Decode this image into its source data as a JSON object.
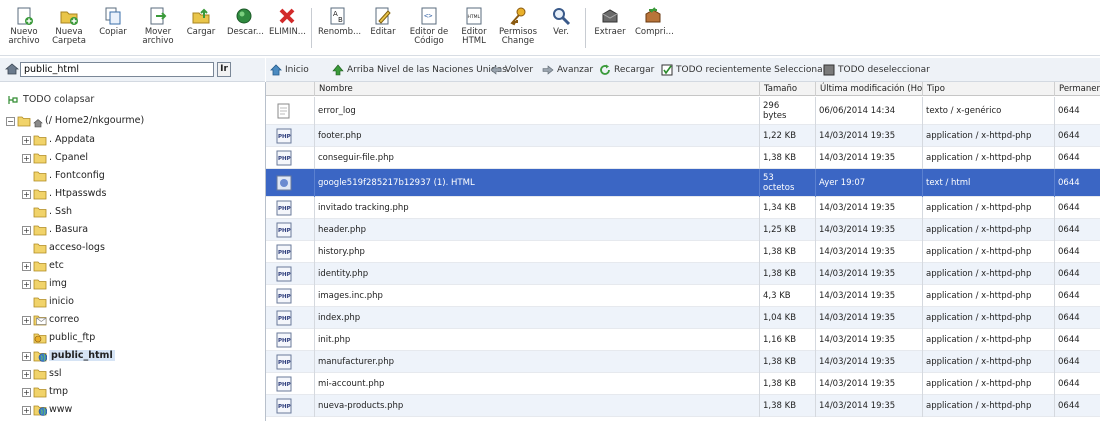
{
  "toolbar": {
    "buttons": [
      {
        "label": "Nuevo\narchivo",
        "icon": "new-file-icon"
      },
      {
        "label": "Nueva\nCarpeta",
        "icon": "new-folder-icon"
      },
      {
        "label": "Copiar",
        "icon": "copy-icon"
      },
      {
        "label": "Mover\narchivo",
        "icon": "move-file-icon"
      },
      {
        "label": "Cargar",
        "icon": "upload-icon"
      },
      {
        "label": "Descar...",
        "icon": "download-icon"
      },
      {
        "label": "ELIMIN...",
        "icon": "delete-icon"
      },
      {
        "label": "Renomb...",
        "icon": "rename-icon"
      },
      {
        "label": "Editar",
        "icon": "edit-icon"
      },
      {
        "label": "Editor de\nCódigo",
        "icon": "code-editor-icon"
      },
      {
        "label": "Editor\nHTML",
        "icon": "html-editor-icon"
      },
      {
        "label": "Permisos\nChange",
        "icon": "permissions-icon"
      },
      {
        "label": "Ver.",
        "icon": "view-icon"
      },
      {
        "label": "Extraer",
        "icon": "extract-icon"
      },
      {
        "label": "Compri...",
        "icon": "compress-icon"
      }
    ]
  },
  "path": {
    "value": "public_html",
    "go_label": "Ir"
  },
  "actions": [
    {
      "label": "Inicio",
      "icon": "home-icon"
    },
    {
      "label": "Arriba Nivel de las Naciones Unidas",
      "icon": "up-level-icon"
    },
    {
      "label": "Volver",
      "icon": "back-icon"
    },
    {
      "label": "Avanzar",
      "icon": "forward-icon"
    },
    {
      "label": "Recargar",
      "icon": "reload-icon"
    },
    {
      "label": "TODO recientemente Seleccionar",
      "icon": "select-all-icon"
    },
    {
      "label": "TODO deseleccionar",
      "icon": "deselect-all-icon"
    }
  ],
  "tree": {
    "collapse_label": "TODO colapsar",
    "root_label": "(/ Home2/nkgourme)",
    "items": [
      {
        "label": ". Appdata",
        "expandable": true,
        "icon": "folder"
      },
      {
        "label": ". Cpanel",
        "expandable": true,
        "icon": "folder"
      },
      {
        "label": ". Fontconfig",
        "expandable": false,
        "icon": "folder"
      },
      {
        "label": ". Htpasswds",
        "expandable": true,
        "icon": "folder"
      },
      {
        "label": ". Ssh",
        "expandable": false,
        "icon": "folder"
      },
      {
        "label": ". Basura",
        "expandable": true,
        "icon": "folder"
      },
      {
        "label": "acceso-logs",
        "expandable": false,
        "icon": "folder"
      },
      {
        "label": "etc",
        "expandable": true,
        "icon": "folder"
      },
      {
        "label": "img",
        "expandable": true,
        "icon": "folder"
      },
      {
        "label": "inicio",
        "expandable": false,
        "icon": "folder"
      },
      {
        "label": "correo",
        "expandable": true,
        "icon": "mail-folder"
      },
      {
        "label": "public_ftp",
        "expandable": false,
        "icon": "ftp-folder"
      },
      {
        "label": "public_html",
        "expandable": true,
        "icon": "globe-folder",
        "selected": true
      },
      {
        "label": "ssl",
        "expandable": true,
        "icon": "folder"
      },
      {
        "label": "tmp",
        "expandable": true,
        "icon": "folder"
      },
      {
        "label": "www",
        "expandable": true,
        "icon": "globe-folder"
      }
    ]
  },
  "table": {
    "columns": [
      "Nombre",
      "Tamaño",
      "Última modificación (Hora",
      "Tipo",
      "Permaner"
    ],
    "rows": [
      {
        "icon": "text-file",
        "name": "error_log",
        "size": "296\nbytes",
        "modified": "06/06/2014 14:34",
        "type": "texto / x-genérico",
        "perm": "0644"
      },
      {
        "icon": "php-file",
        "name": "footer.php",
        "size": "1,22 KB",
        "modified": "14/03/2014 19:35",
        "type": "application / x-httpd-php",
        "perm": "0644"
      },
      {
        "icon": "php-file",
        "name": "conseguir-file.php",
        "size": "1,38 KB",
        "modified": "14/03/2014 19:35",
        "type": "application / x-httpd-php",
        "perm": "0644"
      },
      {
        "icon": "html-file",
        "name": "google519f285217b12937 (1). HTML",
        "size": "53\noctetos",
        "modified": "Ayer 19:07",
        "type": "text / html",
        "perm": "0644",
        "selected": true
      },
      {
        "icon": "php-file",
        "name": "invitado tracking.php",
        "size": "1,34 KB",
        "modified": "14/03/2014 19:35",
        "type": "application / x-httpd-php",
        "perm": "0644"
      },
      {
        "icon": "php-file",
        "name": "header.php",
        "size": "1,25 KB",
        "modified": "14/03/2014 19:35",
        "type": "application / x-httpd-php",
        "perm": "0644"
      },
      {
        "icon": "php-file",
        "name": "history.php",
        "size": "1,38 KB",
        "modified": "14/03/2014 19:35",
        "type": "application / x-httpd-php",
        "perm": "0644"
      },
      {
        "icon": "php-file",
        "name": "identity.php",
        "size": "1,38 KB",
        "modified": "14/03/2014 19:35",
        "type": "application / x-httpd-php",
        "perm": "0644"
      },
      {
        "icon": "php-file",
        "name": "images.inc.php",
        "size": "4,3 KB",
        "modified": "14/03/2014 19:35",
        "type": "application / x-httpd-php",
        "perm": "0644"
      },
      {
        "icon": "php-file",
        "name": "index.php",
        "size": "1,04 KB",
        "modified": "14/03/2014 19:35",
        "type": "application / x-httpd-php",
        "perm": "0644"
      },
      {
        "icon": "php-file",
        "name": "init.php",
        "size": "1,16 KB",
        "modified": "14/03/2014 19:35",
        "type": "application / x-httpd-php",
        "perm": "0644"
      },
      {
        "icon": "php-file",
        "name": "manufacturer.php",
        "size": "1,38 KB",
        "modified": "14/03/2014 19:35",
        "type": "application / x-httpd-php",
        "perm": "0644"
      },
      {
        "icon": "php-file",
        "name": "mi-account.php",
        "size": "1,38 KB",
        "modified": "14/03/2014 19:35",
        "type": "application / x-httpd-php",
        "perm": "0644"
      },
      {
        "icon": "php-file",
        "name": "nueva-products.php",
        "size": "1,38 KB",
        "modified": "14/03/2014 19:35",
        "type": "application / x-httpd-php",
        "perm": "0644"
      }
    ]
  },
  "colors": {
    "selected_row": "#3b66c4",
    "alt_row": "#eef3fa",
    "accent_blue": "#2f6fb3"
  }
}
